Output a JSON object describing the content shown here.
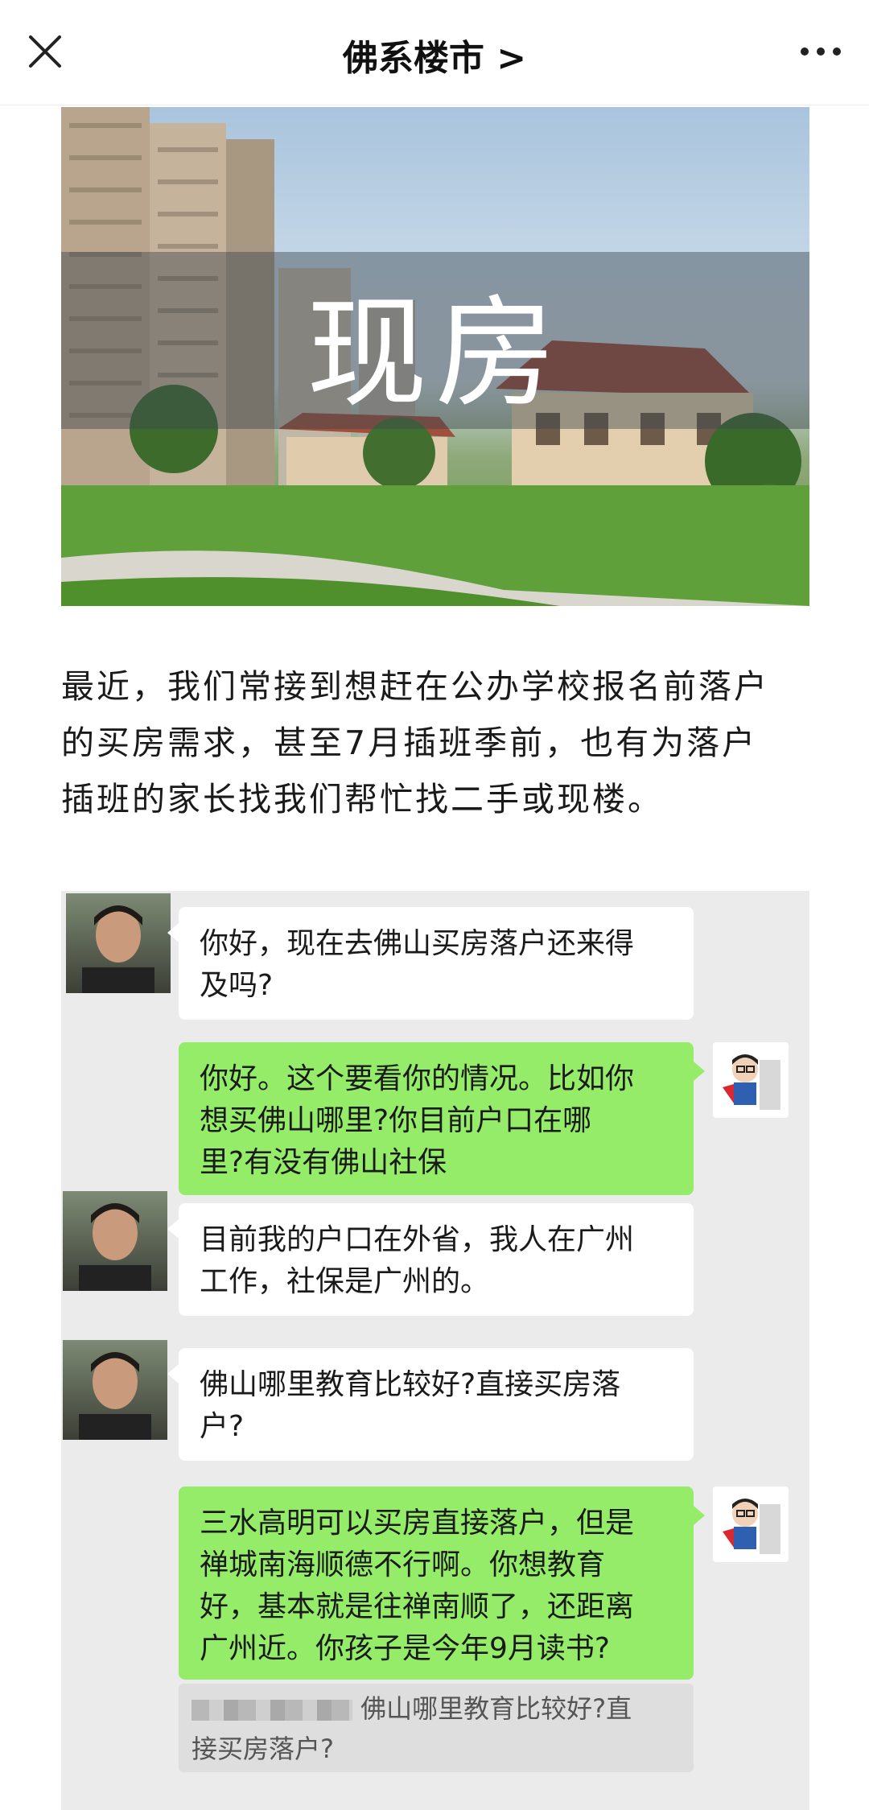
{
  "nav": {
    "title": "佛系楼市 >",
    "close_icon": "close-icon",
    "more_icon": "more-dots-icon"
  },
  "hero": {
    "title": "现房"
  },
  "article": {
    "paragraph_lines": [
      "最近，我们常接到想赶在公办学校报名前落户",
      "的买房需求，甚至7月插班季前，也有为落户",
      "插班的家长找我们帮忙找二手或现楼。"
    ]
  },
  "chat": {
    "messages": [
      {
        "side": "left",
        "lines": [
          "你好，现在去佛山买房落户还来得",
          "及吗?"
        ]
      },
      {
        "side": "right",
        "lines": [
          "你好。这个要看你的情况。比如你",
          "想买佛山哪里?你目前户口在哪",
          "里?有没有佛山社保"
        ]
      },
      {
        "side": "left",
        "lines": [
          "目前我的户口在外省，我人在广州",
          "工作，社保是广州的。"
        ]
      },
      {
        "side": "left",
        "lines": [
          "佛山哪里教育比较好?直接买房落",
          "户?"
        ]
      },
      {
        "side": "right",
        "lines": [
          "三水高明可以买房直接落户，但是",
          "禅城南海顺德不行啊。你想教育",
          "好，基本就是往禅南顺了，还距离",
          "广州近。你孩子是今年9月读书?"
        ]
      }
    ],
    "quote": {
      "line1": "佛山哪里教育比较好?直",
      "line2": "接买房落户?"
    }
  },
  "colors": {
    "right_bubble": "#95ec69",
    "left_bubble": "#ffffff",
    "chat_bg": "#ebebeb"
  }
}
